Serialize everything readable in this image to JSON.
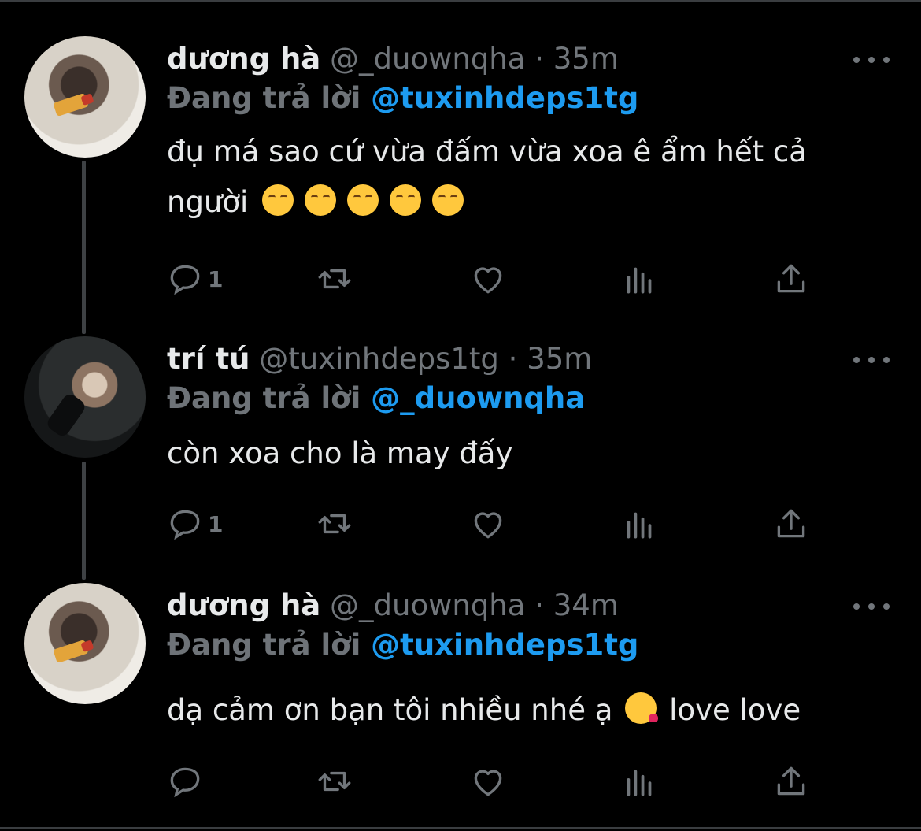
{
  "tweets": [
    {
      "name": "dương hà",
      "handle": "@_duownqha",
      "separator": "·",
      "time": "35m",
      "reply_prefix": "Đang trả lời",
      "reply_to": "@tuxinhdeps1tg",
      "text_line1": "đụ má sao cứ vừa đấm vừa xoa ê ẩm hết cả",
      "text_line2": "người",
      "reply_count": "1",
      "avatar": "avatar-duong-ha"
    },
    {
      "name": "trí tú",
      "handle": "@tuxinhdeps1tg",
      "separator": "·",
      "time": "35m",
      "reply_prefix": "Đang trả lời",
      "reply_to": "@_duownqha",
      "text_line1": "còn xoa cho là may đấy",
      "reply_count": "1",
      "avatar": "avatar-tri-tu"
    },
    {
      "name": "dương hà",
      "handle": "@_duownqha",
      "separator": "·",
      "time": "34m",
      "reply_prefix": "Đang trả lời",
      "reply_to": "@tuxinhdeps1tg",
      "text_before": "dạ cảm ơn bạn tôi nhiều nhé ạ",
      "text_after": "love love",
      "reply_count": "",
      "avatar": "avatar-duong-ha"
    }
  ],
  "icons": {
    "reply": "reply-icon",
    "retweet": "retweet-icon",
    "like": "heart-icon",
    "views": "analytics-icon",
    "share": "share-icon",
    "more": "more-dots-icon",
    "blush": "smiling-face-emoji",
    "kiss": "face-blowing-kiss-emoji"
  },
  "colors": {
    "background": "#000000",
    "text": "#e7e9ea",
    "muted": "#71767b",
    "mention": "#1d9bf0"
  }
}
